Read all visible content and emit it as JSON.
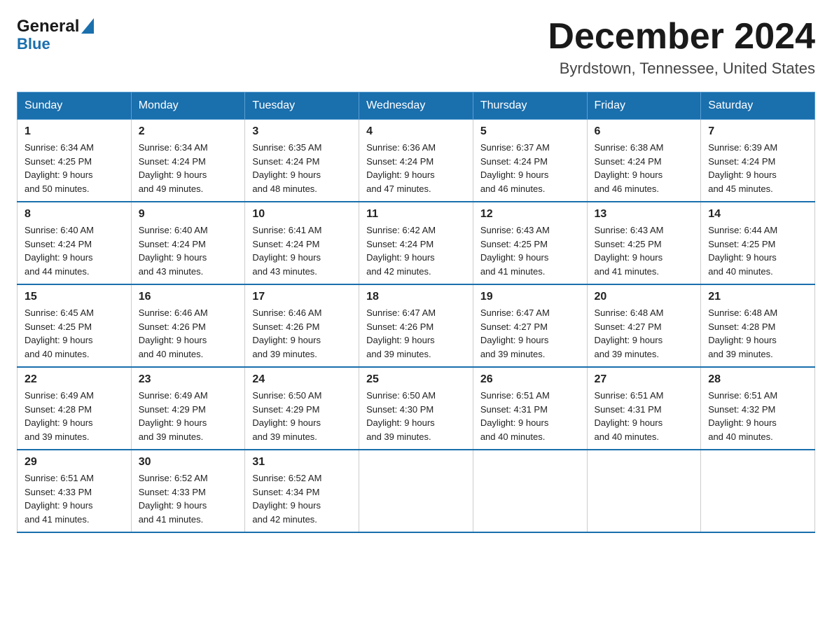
{
  "header": {
    "logo_general": "General",
    "logo_blue": "Blue",
    "month_title": "December 2024",
    "location": "Byrdstown, Tennessee, United States"
  },
  "days_of_week": [
    "Sunday",
    "Monday",
    "Tuesday",
    "Wednesday",
    "Thursday",
    "Friday",
    "Saturday"
  ],
  "weeks": [
    [
      {
        "day": "1",
        "sunrise": "6:34 AM",
        "sunset": "4:25 PM",
        "daylight": "9 hours and 50 minutes."
      },
      {
        "day": "2",
        "sunrise": "6:34 AM",
        "sunset": "4:24 PM",
        "daylight": "9 hours and 49 minutes."
      },
      {
        "day": "3",
        "sunrise": "6:35 AM",
        "sunset": "4:24 PM",
        "daylight": "9 hours and 48 minutes."
      },
      {
        "day": "4",
        "sunrise": "6:36 AM",
        "sunset": "4:24 PM",
        "daylight": "9 hours and 47 minutes."
      },
      {
        "day": "5",
        "sunrise": "6:37 AM",
        "sunset": "4:24 PM",
        "daylight": "9 hours and 46 minutes."
      },
      {
        "day": "6",
        "sunrise": "6:38 AM",
        "sunset": "4:24 PM",
        "daylight": "9 hours and 46 minutes."
      },
      {
        "day": "7",
        "sunrise": "6:39 AM",
        "sunset": "4:24 PM",
        "daylight": "9 hours and 45 minutes."
      }
    ],
    [
      {
        "day": "8",
        "sunrise": "6:40 AM",
        "sunset": "4:24 PM",
        "daylight": "9 hours and 44 minutes."
      },
      {
        "day": "9",
        "sunrise": "6:40 AM",
        "sunset": "4:24 PM",
        "daylight": "9 hours and 43 minutes."
      },
      {
        "day": "10",
        "sunrise": "6:41 AM",
        "sunset": "4:24 PM",
        "daylight": "9 hours and 43 minutes."
      },
      {
        "day": "11",
        "sunrise": "6:42 AM",
        "sunset": "4:24 PM",
        "daylight": "9 hours and 42 minutes."
      },
      {
        "day": "12",
        "sunrise": "6:43 AM",
        "sunset": "4:25 PM",
        "daylight": "9 hours and 41 minutes."
      },
      {
        "day": "13",
        "sunrise": "6:43 AM",
        "sunset": "4:25 PM",
        "daylight": "9 hours and 41 minutes."
      },
      {
        "day": "14",
        "sunrise": "6:44 AM",
        "sunset": "4:25 PM",
        "daylight": "9 hours and 40 minutes."
      }
    ],
    [
      {
        "day": "15",
        "sunrise": "6:45 AM",
        "sunset": "4:25 PM",
        "daylight": "9 hours and 40 minutes."
      },
      {
        "day": "16",
        "sunrise": "6:46 AM",
        "sunset": "4:26 PM",
        "daylight": "9 hours and 40 minutes."
      },
      {
        "day": "17",
        "sunrise": "6:46 AM",
        "sunset": "4:26 PM",
        "daylight": "9 hours and 39 minutes."
      },
      {
        "day": "18",
        "sunrise": "6:47 AM",
        "sunset": "4:26 PM",
        "daylight": "9 hours and 39 minutes."
      },
      {
        "day": "19",
        "sunrise": "6:47 AM",
        "sunset": "4:27 PM",
        "daylight": "9 hours and 39 minutes."
      },
      {
        "day": "20",
        "sunrise": "6:48 AM",
        "sunset": "4:27 PM",
        "daylight": "9 hours and 39 minutes."
      },
      {
        "day": "21",
        "sunrise": "6:48 AM",
        "sunset": "4:28 PM",
        "daylight": "9 hours and 39 minutes."
      }
    ],
    [
      {
        "day": "22",
        "sunrise": "6:49 AM",
        "sunset": "4:28 PM",
        "daylight": "9 hours and 39 minutes."
      },
      {
        "day": "23",
        "sunrise": "6:49 AM",
        "sunset": "4:29 PM",
        "daylight": "9 hours and 39 minutes."
      },
      {
        "day": "24",
        "sunrise": "6:50 AM",
        "sunset": "4:29 PM",
        "daylight": "9 hours and 39 minutes."
      },
      {
        "day": "25",
        "sunrise": "6:50 AM",
        "sunset": "4:30 PM",
        "daylight": "9 hours and 39 minutes."
      },
      {
        "day": "26",
        "sunrise": "6:51 AM",
        "sunset": "4:31 PM",
        "daylight": "9 hours and 40 minutes."
      },
      {
        "day": "27",
        "sunrise": "6:51 AM",
        "sunset": "4:31 PM",
        "daylight": "9 hours and 40 minutes."
      },
      {
        "day": "28",
        "sunrise": "6:51 AM",
        "sunset": "4:32 PM",
        "daylight": "9 hours and 40 minutes."
      }
    ],
    [
      {
        "day": "29",
        "sunrise": "6:51 AM",
        "sunset": "4:33 PM",
        "daylight": "9 hours and 41 minutes."
      },
      {
        "day": "30",
        "sunrise": "6:52 AM",
        "sunset": "4:33 PM",
        "daylight": "9 hours and 41 minutes."
      },
      {
        "day": "31",
        "sunrise": "6:52 AM",
        "sunset": "4:34 PM",
        "daylight": "9 hours and 42 minutes."
      },
      null,
      null,
      null,
      null
    ]
  ],
  "labels": {
    "sunrise": "Sunrise:",
    "sunset": "Sunset:",
    "daylight": "Daylight:"
  }
}
